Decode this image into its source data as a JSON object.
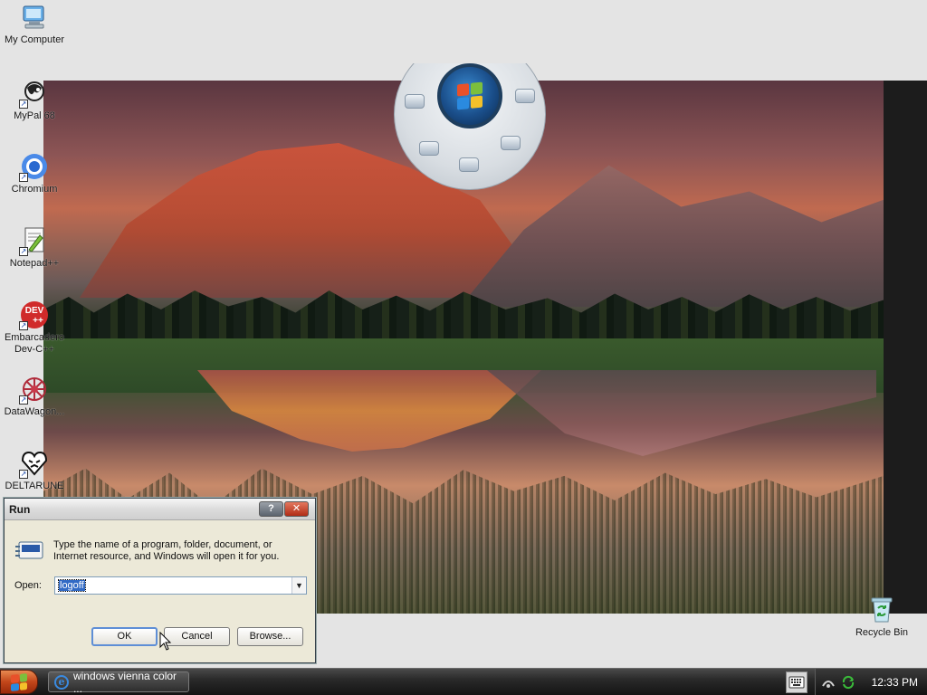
{
  "desktop": {
    "icons": [
      {
        "label": "My Computer",
        "glyph": "computer-icon"
      },
      {
        "label": "MyPal 68",
        "glyph": "mypal-icon"
      },
      {
        "label": "Chromium",
        "glyph": "chromium-icon"
      },
      {
        "label": "Notepad++",
        "glyph": "notepadpp-icon"
      },
      {
        "label": "Embarcadero Dev-C++",
        "glyph": "devcpp-icon",
        "badge": "DEV ++"
      },
      {
        "label": "DataWagon...",
        "glyph": "datawagon-icon"
      },
      {
        "label": "DELTARUNE",
        "glyph": "deltarune-icon"
      },
      {
        "label": "Recycle Bin",
        "glyph": "recycle-bin-icon"
      }
    ]
  },
  "run_dialog": {
    "title": "Run",
    "help_label": "?",
    "close_label": "✕",
    "description": "Type the name of a program, folder, document, or Internet resource, and Windows will open it for you.",
    "open_label": "Open:",
    "open_value": "logoff",
    "ok_label": "OK",
    "cancel_label": "Cancel",
    "browse_label": "Browse..."
  },
  "taskbar": {
    "task_label": "windows vienna color ...",
    "clock": "12:33 PM"
  },
  "colors": {
    "accent_start": "#c2461a",
    "selection": "#316ac5",
    "close_button": "#b02c16"
  }
}
